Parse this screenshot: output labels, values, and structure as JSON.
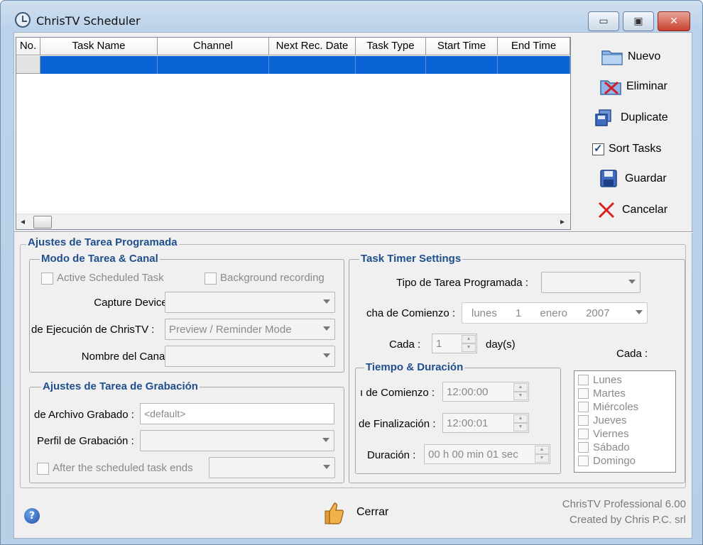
{
  "window": {
    "title": "ChrisTV Scheduler",
    "min_glyph": "▭",
    "max_glyph": "▣",
    "close_glyph": "✕"
  },
  "grid": {
    "columns": [
      "No.",
      "Task Name",
      "Channel",
      "Next Rec. Date",
      "Task Type",
      "Start Time",
      "End Time"
    ],
    "selection_color": "#0a63d4",
    "scroll_left": "◂",
    "scroll_right": "▸"
  },
  "side": {
    "nuevo": "Nuevo",
    "eliminar": "Eliminar",
    "duplicate": "Duplicate",
    "sort_tasks": "Sort Tasks",
    "sort_checked": true,
    "guardar": "Guardar",
    "cancelar": "Cancelar"
  },
  "ajustes": {
    "title": "Ajustes de Tarea Programada",
    "modo": {
      "title": "Modo de Tarea & Canal",
      "active_task": "Active Scheduled Task",
      "background": "Background recording",
      "capture_device": "Capture Device :",
      "ejecucion": "de Ejecución de ChrisTV :",
      "ejecucion_value": "Preview / Reminder Mode",
      "nombre_canal": "Nombre del Canal :"
    },
    "grabacion": {
      "title": "Ajustes de Tarea de Grabación",
      "archivo": "de Archivo Grabado :",
      "archivo_value": "<default>",
      "perfil": "Perfil de Grabación :",
      "after": "After the scheduled task ends"
    }
  },
  "timer": {
    "title": "Task Timer Settings",
    "tipo": "Tipo de Tarea Programada :",
    "fecha": "cha de Comienzo :",
    "fecha_day_name": "lunes",
    "fecha_day": "1",
    "fecha_month": "enero",
    "fecha_year": "2007",
    "cada": "Cada :",
    "cada_value": "1",
    "days_unit": "day(s)",
    "cada_right": "Cada :",
    "tiempo": {
      "title": "Tiempo & Duración",
      "comienzo": "ı de Comienzo :",
      "comienzo_value": "12:00:00",
      "finalizacion": "de Finalización :",
      "finalizacion_value": "12:00:01",
      "duracion": "Duración :",
      "duracion_value": "00 h 00 min 01 sec"
    },
    "days": [
      "Lunes",
      "Martes",
      "Miércoles",
      "Jueves",
      "Viernes",
      "Sábado",
      "Domingo"
    ]
  },
  "footer": {
    "help": "?",
    "cerrar": "Cerrar",
    "product": "ChrisTV Professional 6.00",
    "created": "Created by Chris P.C. srl"
  }
}
